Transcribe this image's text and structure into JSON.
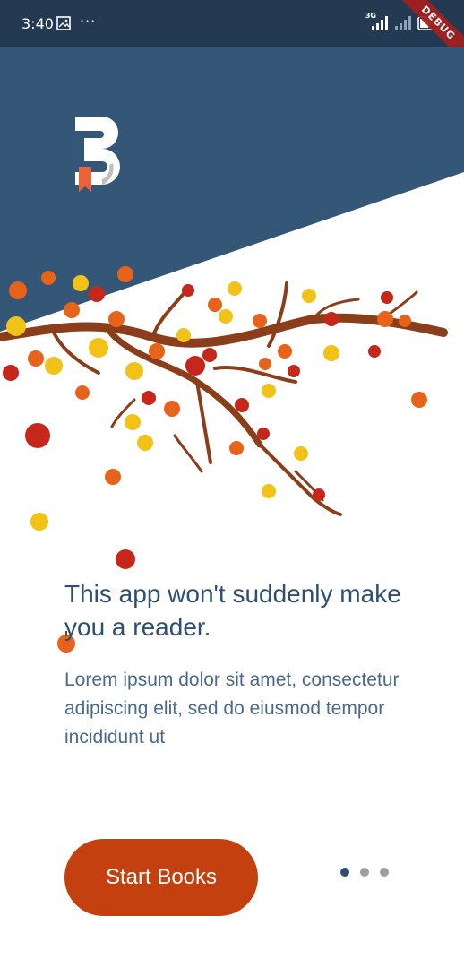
{
  "status_bar": {
    "time": "3:40",
    "more_symbol": "···",
    "network_label": "3G",
    "debug_label": "DEBUG",
    "icons": [
      "gallery-icon",
      "signal-icon",
      "signal-icon",
      "battery-charging-icon"
    ]
  },
  "onboarding": {
    "headline": "This app won't suddenly make you a reader.",
    "body": "Lorem ipsum dolor sit amet, consectetur adipiscing elit, sed do eiusmod tempor incididunt ut",
    "start_button_label": "Start Books",
    "page_count": 3,
    "active_page": 1
  },
  "colors": {
    "header_blue": "#345777",
    "status_bar": "#243a52",
    "accent_orange": "#c5400f",
    "headline_text": "#2f4f72",
    "body_text": "#4a6a8c",
    "dot_inactive": "#9e9e9e"
  }
}
